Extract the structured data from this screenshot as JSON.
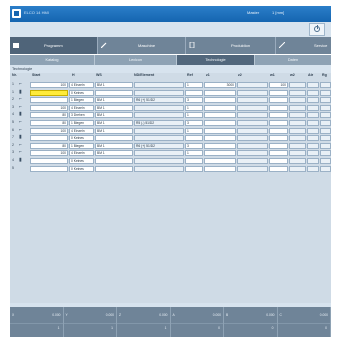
{
  "titlebar": {
    "app_title": "ELCO 14 HMI",
    "user": "Master",
    "mode": "1 [mm]"
  },
  "main_tabs": [
    {
      "label": "Programm",
      "icon": "folder-icon"
    },
    {
      "label": "Maschine",
      "icon": "wrench-icon"
    },
    {
      "label": "Produktion",
      "icon": "document-icon"
    },
    {
      "label": "Service",
      "icon": "tool-icon"
    }
  ],
  "sub_tabs": [
    "Katalog",
    "Lexicon",
    "Technologie",
    "Daten"
  ],
  "section_title": "Technologie",
  "columns": [
    "Nr.",
    "Start",
    "H",
    "WS",
    "ND/Element",
    "Ref",
    "z1",
    "z2",
    "w1",
    "w2",
    "Atr",
    "Rg"
  ],
  "rows": [
    {
      "nr": "1",
      "sym": "⌐",
      "start": "100",
      "h": "4 Einzeln",
      "ws": "BM 1",
      "nd": "",
      "ref": "1",
      "z1": "3000",
      "z2": "",
      "w1": "100",
      "w2": ""
    },
    {
      "nr": "1",
      "sym": "▮",
      "start": "",
      "h": "0 Keines",
      "ws": "",
      "nd": "",
      "ref": "",
      "z1": "",
      "z2": "",
      "w1": "",
      "w2": ""
    },
    {
      "nr": "2",
      "sym": "⌐",
      "start": "",
      "h": "1 Biegen",
      "ws": "BM 1",
      "nd": "R6 (+) 51/D2",
      "ref": "3",
      "z1": "",
      "z2": "",
      "w1": "",
      "w2": ""
    },
    {
      "nr": "3",
      "sym": "⌐",
      "start": "100",
      "h": "4 Einzeln",
      "ws": "BM 1",
      "nd": "",
      "ref": "1",
      "z1": "",
      "z2": "",
      "w1": "",
      "w2": ""
    },
    {
      "nr": "4",
      "sym": "▮",
      "start": "80",
      "h": "3 Drehen",
      "ws": "BM 1",
      "nd": "",
      "ref": "1",
      "z1": "",
      "z2": "",
      "w1": "",
      "w2": ""
    },
    {
      "nr": "5",
      "sym": "⌐",
      "start": "80",
      "h": "1 Biegen",
      "ws": "BM 1",
      "nd": "R5 (-) 51/D2",
      "ref": "3",
      "z1": "",
      "z2": "",
      "w1": "",
      "w2": ""
    },
    {
      "nr": "6",
      "sym": "⌐",
      "start": "100",
      "h": "4 Einzeln",
      "ws": "BM 1",
      "nd": "",
      "ref": "1",
      "z1": "",
      "z2": "",
      "w1": "",
      "w2": ""
    },
    {
      "nr": "7",
      "sym": "▮",
      "start": "",
      "h": "0 Keines",
      "ws": "",
      "nd": "",
      "ref": "",
      "z1": "",
      "z2": "",
      "w1": "",
      "w2": ""
    },
    {
      "nr": "2",
      "sym": "⌐",
      "start": "80",
      "h": "1 Biegen",
      "ws": "BM 1",
      "nd": "R6 (+) 51/D2",
      "ref": "3",
      "z1": "",
      "z2": "",
      "w1": "",
      "w2": ""
    },
    {
      "nr": "3",
      "sym": "⌐",
      "start": "100",
      "h": "4 Einzeln",
      "ws": "BM 1",
      "nd": "",
      "ref": "1",
      "z1": "",
      "z2": "",
      "w1": "",
      "w2": ""
    },
    {
      "nr": "4",
      "sym": "▮",
      "start": "",
      "h": "0 Keines",
      "ws": "",
      "nd": "",
      "ref": "",
      "z1": "",
      "z2": "",
      "w1": "",
      "w2": ""
    },
    {
      "nr": "5",
      "sym": "",
      "start": "",
      "h": "0 Keines",
      "ws": "",
      "nd": "",
      "ref": "",
      "z1": "",
      "z2": "",
      "w1": "",
      "w2": ""
    }
  ],
  "footer": [
    {
      "label": "X",
      "value": "0.000",
      "bottom": "1"
    },
    {
      "label": "Y",
      "value": "0.000",
      "bottom": "1"
    },
    {
      "label": "Z",
      "value": "0.000",
      "bottom": "1"
    },
    {
      "label": "A",
      "value": "0.000",
      "bottom": "0"
    },
    {
      "label": "B",
      "value": "0.000",
      "bottom": "0"
    },
    {
      "label": "C",
      "value": "0.000",
      "bottom": "0"
    }
  ],
  "colors": {
    "titlebar": "#1565b0",
    "highlight": "#ffeb3b",
    "toolbar": "#6f8498"
  }
}
